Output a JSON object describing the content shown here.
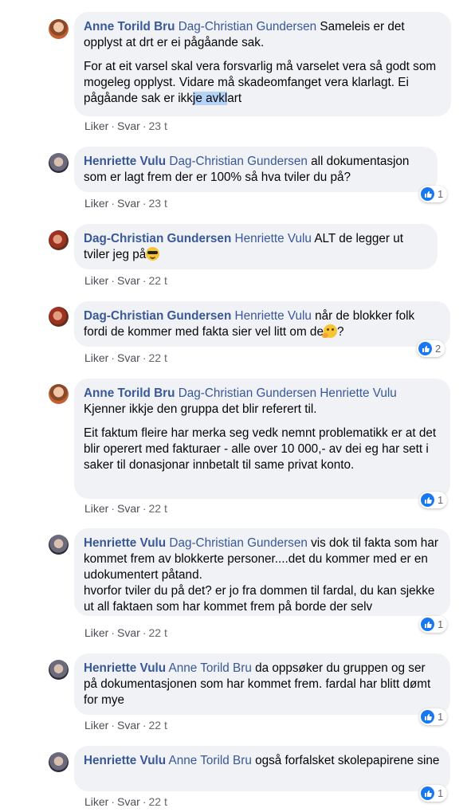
{
  "actions": {
    "like": "Liker",
    "reply": "Svar",
    "separator": "·"
  },
  "comments": [
    {
      "author": "Anne Torild Bru",
      "mentions": "Dag-Christian Gundersen",
      "text1": " Sameleis er det opplyst at drt er ei pågåande sak.",
      "para2_a": "For at eit varsel skal vera forsvarlig må varselet vera så godt som mogeleg opplyst. Vidare må skadeomfanget vera klarlagt. Ei pågåande sak er ikk",
      "para2_sel": "je avkl",
      "para2_b": "art",
      "time": "23 t"
    },
    {
      "author": "Henriette Vulu",
      "mentions": "Dag-Christian Gundersen",
      "text1": " all dokumentasjon som er lagt frem der er 100% så hva tviler du på?",
      "time": "23 t",
      "reactions": "1"
    },
    {
      "author": "Dag-Christian Gundersen",
      "mentions": "Henriette Vulu",
      "text1": " ALT de legger ut tviler jeg på",
      "emoji": "smiling-face-with-sunglasses",
      "time": "22 t"
    },
    {
      "author": "Dag-Christian Gundersen",
      "mentions": "Henriette Vulu",
      "text1": " når de blokker folk fordi de kommer med fakta sier vel litt om de",
      "emoji": "thinking-face",
      "text_after": "?",
      "time": "22 t",
      "reactions": "2"
    },
    {
      "author": "Anne Torild Bru",
      "mentions": "Dag-Christian Gundersen Henriette Vulu",
      "line2": "Kjenner ikkje den gruppa det blir referert til.",
      "para2": "Eit faktum fleire har merka seg vedk nemnt problematikk er at det blir operert med fakturaer - alle over 10 000,- av dei eg har sett i saker til donasjonar innbetalt til same privat konto.",
      "time": "22 t",
      "reactions": "1"
    },
    {
      "author": "Henriette Vulu",
      "mentions": "Dag-Christian Gundersen",
      "text1": " vis dok til fakta som har kommet frem av blokkerte personer....det du kommer med er en udokumentert påtand.\nhvorfor tviler du på det? er jo fra dommen til fardal, du kan sjekke ut all faktaen som har kommet frem på borde der selv",
      "time": "22 t",
      "reactions": "1"
    },
    {
      "author": "Henriette Vulu",
      "mentions": "Anne Torild Bru",
      "text1": " da oppsøker du gruppen og ser på dokumentasjonen som har kommet frem. fardal har blitt dømt for mye",
      "time": "22 t",
      "reactions": "1"
    },
    {
      "author": "Henriette Vulu",
      "mentions": "Anne Torild Bru",
      "text1": " også forfalsket skolepapirene sine",
      "time": "22 t",
      "reactions": "1"
    }
  ]
}
